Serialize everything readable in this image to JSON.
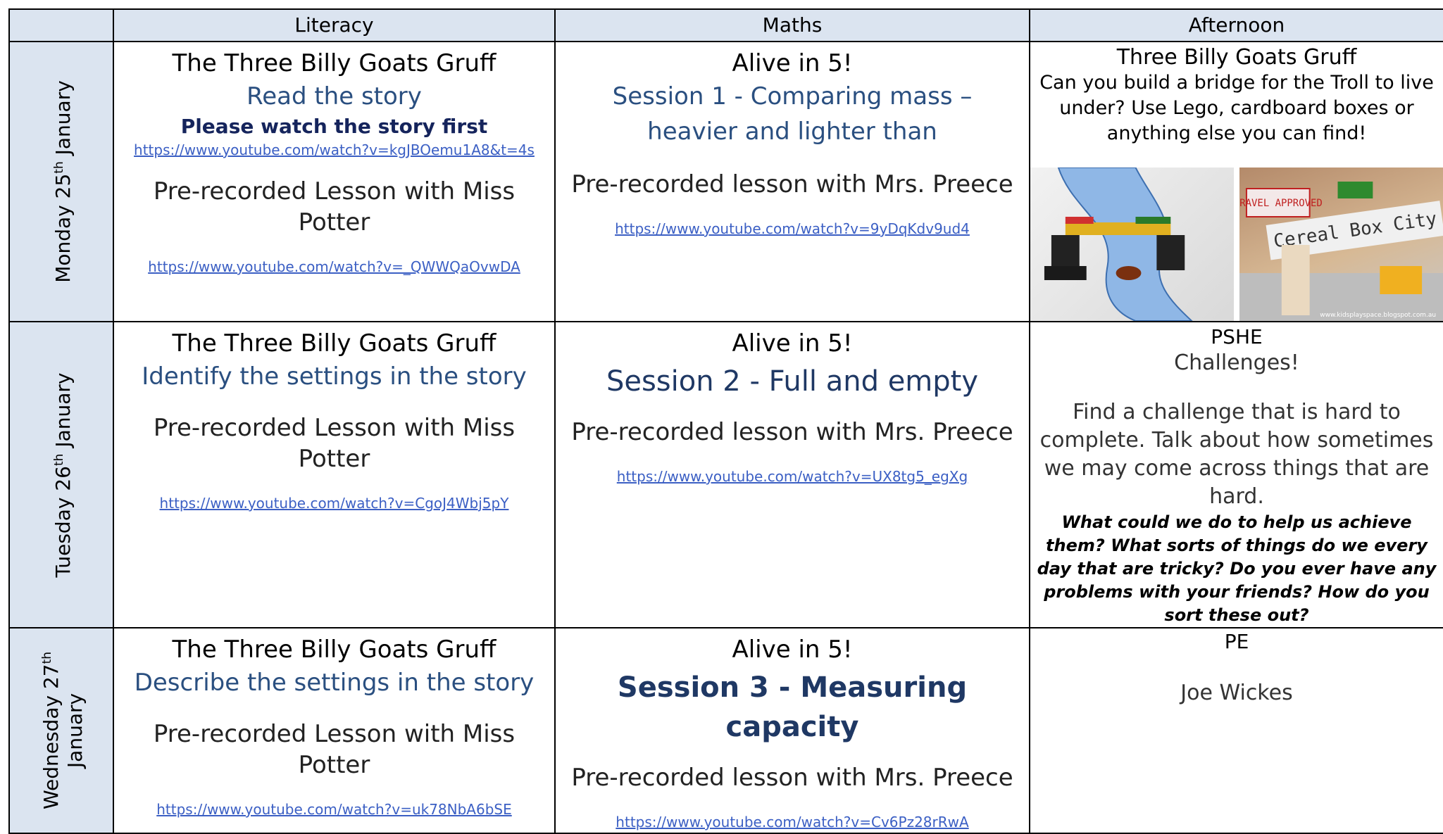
{
  "headers": {
    "blank": "",
    "literacy": "Literacy",
    "maths": "Maths",
    "afternoon": "Afternoon"
  },
  "days": [
    {
      "day_label_pre": "Monday 25",
      "day_label_sup": "th",
      "day_label_post": " January",
      "literacy": {
        "title": "The Three Billy Goats Gruff",
        "task": "Read the story",
        "note": "Please watch the story first",
        "story_link": "https://www.youtube.com/watch?v=kgJBOemu1A8&t=4s",
        "lesson": "Pre-recorded Lesson with Miss Potter",
        "lesson_link": "https://www.youtube.com/watch?v=_QWWQaOvwDA"
      },
      "maths": {
        "title": "Alive in 5!",
        "session": "Session 1 - Comparing mass – heavier and lighter than",
        "lesson": "Pre-recorded lesson with Mrs. Preece",
        "lesson_link": "https://www.youtube.com/watch?v=9yDqKdv9ud4"
      },
      "afternoon": {
        "title": "Three Billy Goats Gruff",
        "text": "Can you build a bridge for the Troll to live under? Use Lego, cardboard boxes or anything else you can find!",
        "photo1_caption": "",
        "photo2_sign1": "TRAVEL APPROVED",
        "photo2_sign2": "Cereal Box City",
        "photo2_watermark": "www.kidsplayspace.blogspot.com.au"
      }
    },
    {
      "day_label_pre": "Tuesday 26",
      "day_label_sup": "th",
      "day_label_post": " January",
      "literacy": {
        "title": "The Three Billy Goats Gruff",
        "task": "Identify the settings in the story",
        "lesson": "Pre-recorded Lesson with Miss Potter",
        "lesson_link": "https://www.youtube.com/watch?v=CgoJ4Wbj5pY"
      },
      "maths": {
        "title": "Alive in 5!",
        "session": "Session 2 - Full and empty",
        "lesson": "Pre-recorded lesson with Mrs. Preece",
        "lesson_link": "https://www.youtube.com/watch?v=UX8tg5_egXg"
      },
      "afternoon": {
        "title": "PSHE",
        "subtitle": "Challenges!",
        "body": "Find a challenge that is hard to complete. Talk about how sometimes we may come across things that are hard.",
        "questions": "What could we do to help us achieve them? What sorts of things do we every day that are tricky? Do you ever have any problems with your friends? How do you sort these out?"
      }
    },
    {
      "day_label_pre": "Wednesday 27",
      "day_label_sup": "th",
      "day_label_post": " January",
      "literacy": {
        "title": "The Three Billy Goats Gruff",
        "task": "Describe the settings in the story",
        "lesson": "Pre-recorded Lesson with Miss Potter",
        "lesson_link": "https://www.youtube.com/watch?v=uk78NbA6bSE"
      },
      "maths": {
        "title": "Alive in 5!",
        "session": "Session 3 - Measuring capacity",
        "lesson": "Pre-recorded lesson with Mrs. Preece",
        "lesson_link": "https://www.youtube.com/watch?v=Cv6Pz28rRwA"
      },
      "afternoon": {
        "title": "PE",
        "subtitle": "Joe Wickes"
      }
    }
  ]
}
